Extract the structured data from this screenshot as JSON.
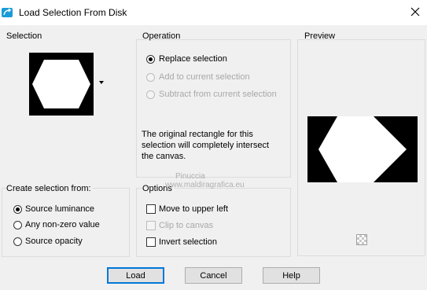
{
  "window": {
    "title": "Load Selection From Disk",
    "accent_color": "#1a9bd7"
  },
  "selection": {
    "label": "Selection"
  },
  "operation": {
    "label": "Operation",
    "options": [
      {
        "label": "Replace selection",
        "checked": true,
        "enabled": true
      },
      {
        "label": "Add to current selection",
        "checked": false,
        "enabled": false
      },
      {
        "label": "Subtract from current selection",
        "checked": false,
        "enabled": false
      }
    ],
    "note_lines": [
      "The original rectangle for this",
      "selection will completely intersect",
      "the canvas."
    ]
  },
  "preview": {
    "label": "Preview"
  },
  "create_from": {
    "label": "Create selection from:",
    "options": [
      {
        "label": "Source luminance",
        "checked": true
      },
      {
        "label": "Any non-zero value",
        "checked": false
      },
      {
        "label": "Source opacity",
        "checked": false
      }
    ]
  },
  "options": {
    "label": "Options",
    "items": [
      {
        "label": "Move to upper left",
        "checked": false,
        "enabled": true
      },
      {
        "label": "Clip to canvas",
        "checked": false,
        "enabled": false
      },
      {
        "label": "Invert selection",
        "checked": false,
        "enabled": true
      }
    ]
  },
  "buttons": {
    "load": "Load",
    "cancel": "Cancel",
    "help": "Help"
  },
  "watermark": {
    "line1": "Pinuccia",
    "line2": "www.maldiragrafica.eu"
  }
}
